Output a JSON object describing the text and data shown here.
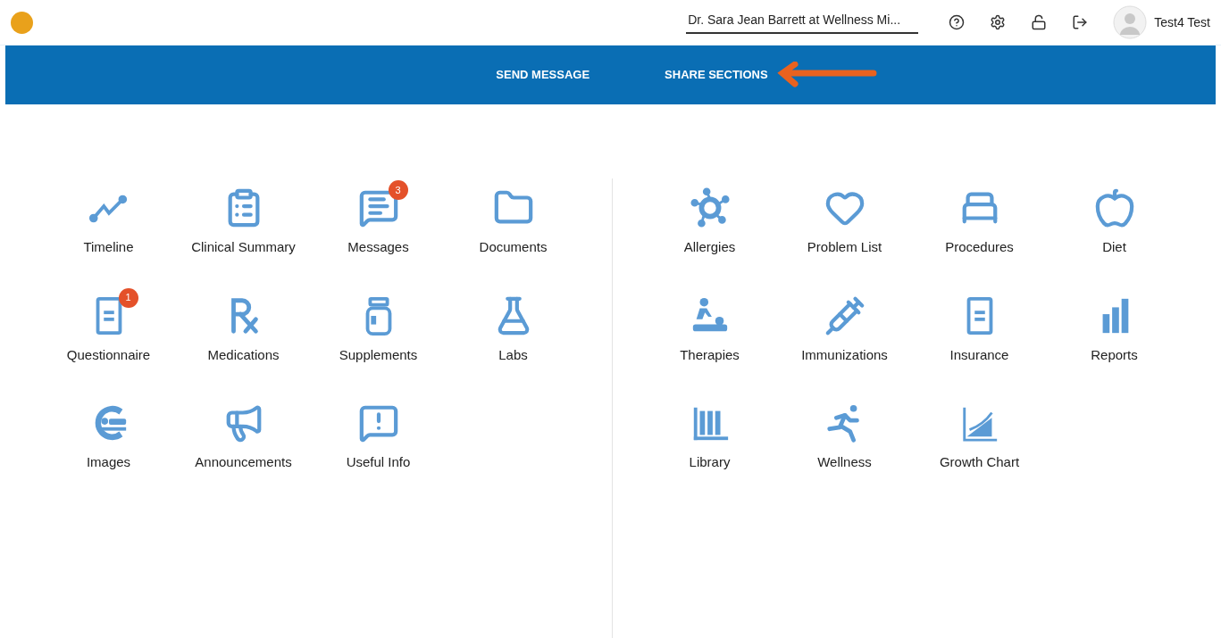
{
  "header": {
    "practice_selector": {
      "value": "Dr. Sara Jean Barrett at Wellness Mi..."
    },
    "user": {
      "name": "Test4 Test"
    }
  },
  "nav": [
    {
      "label": "SEND MESSAGE"
    },
    {
      "label": "SHARE SECTIONS"
    }
  ],
  "panels": [
    {
      "items": [
        {
          "label": "Timeline"
        },
        {
          "label": "Clinical Summary"
        },
        {
          "label": "Messages",
          "badge": "3"
        },
        {
          "label": "Documents"
        },
        {
          "label": "Questionnaire",
          "badge": "1"
        },
        {
          "label": "Medications"
        },
        {
          "label": "Supplements"
        },
        {
          "label": "Labs"
        },
        {
          "label": "Images"
        },
        {
          "label": "Announcements"
        },
        {
          "label": "Useful Info"
        }
      ]
    },
    {
      "items": [
        {
          "label": "Allergies"
        },
        {
          "label": "Problem List"
        },
        {
          "label": "Procedures"
        },
        {
          "label": "Diet"
        },
        {
          "label": "Therapies"
        },
        {
          "label": "Immunizations"
        },
        {
          "label": "Insurance"
        },
        {
          "label": "Reports"
        },
        {
          "label": "Library"
        },
        {
          "label": "Wellness"
        },
        {
          "label": "Growth Chart"
        }
      ]
    }
  ]
}
